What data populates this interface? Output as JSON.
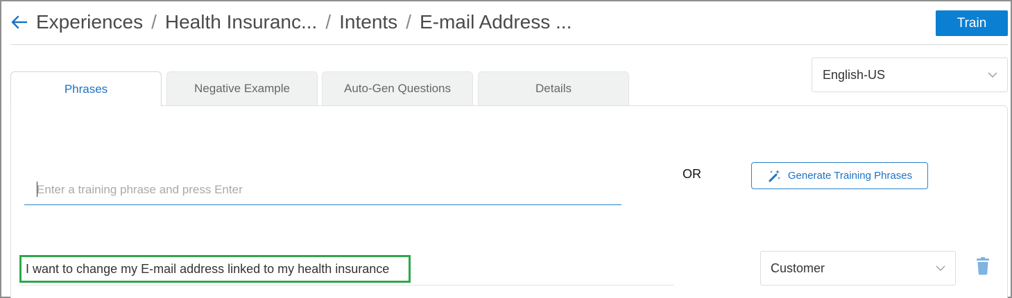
{
  "header": {
    "back_icon": "arrow-left-icon",
    "breadcrumbs": [
      "Experiences",
      "Health Insuranc...",
      "Intents",
      "E-mail Address ..."
    ],
    "separator": "/"
  },
  "toolbar": {
    "train_label": "Train"
  },
  "language": {
    "selected": "English-US"
  },
  "tabs": [
    {
      "label": "Phrases",
      "active": true
    },
    {
      "label": "Negative Example",
      "active": false
    },
    {
      "label": "Auto-Gen Questions",
      "active": false
    },
    {
      "label": "Details",
      "active": false
    }
  ],
  "phrase_entry": {
    "placeholder": "Enter a training phrase and press Enter",
    "value": ""
  },
  "or_label": "OR",
  "generate": {
    "label": "Generate Training Phrases",
    "icon": "magic-wand-icon"
  },
  "phrases": [
    {
      "text": "I want to change my E-mail address linked to my health insurance",
      "role": "Customer"
    }
  ],
  "colors": {
    "accent": "#0b7fd2",
    "highlight": "#2ea84a",
    "trash": "#7fb3e0"
  }
}
